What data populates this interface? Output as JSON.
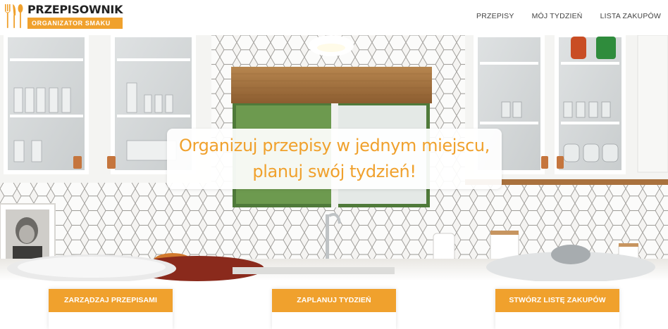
{
  "brand": {
    "title": "PRZEPISOWNIK",
    "subtitle": "ORGANIZATOR SMAKU",
    "logo_icon": "cutlery-icon",
    "accent_color": "#f0a12d"
  },
  "nav": {
    "items": [
      {
        "label": "PRZEPISY"
      },
      {
        "label": "MÓJ TYDZIEŃ"
      },
      {
        "label": "LISTA ZAKUPÓW"
      }
    ]
  },
  "hero": {
    "line1": "Organizuj przepisy w jednym miejscu,",
    "line2": "planuj swój tydzień!"
  },
  "cards": [
    {
      "label": "ZARZĄDZAJ PRZEPISAMI"
    },
    {
      "label": "ZAPLANUJ TYDZIEŃ"
    },
    {
      "label": "STWÓRZ LISTĘ ZAKUPÓW"
    }
  ]
}
